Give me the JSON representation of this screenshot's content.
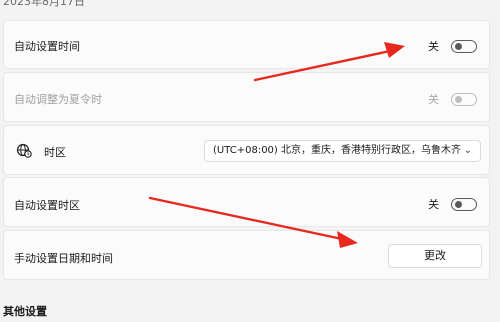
{
  "date_cut": "2023年8月17日",
  "rows": {
    "auto_time": {
      "label": "自动设置时间",
      "state": "关"
    },
    "dst": {
      "label": "自动调整为夏令时",
      "state": "关"
    },
    "timezone": {
      "label": "时区",
      "value": "(UTC+08:00) 北京，重庆，香港特别行政区，乌鲁木齐",
      "icon": "globe-clock-icon"
    },
    "auto_timezone": {
      "label": "自动设置时区",
      "state": "关"
    },
    "manual": {
      "label": "手动设置日期和时间",
      "button": "更改"
    }
  },
  "other_settings": "其他设置",
  "colors": {
    "background": "#f3f3f3",
    "card": "#fbfbfb",
    "arrow": "#e8281f"
  }
}
